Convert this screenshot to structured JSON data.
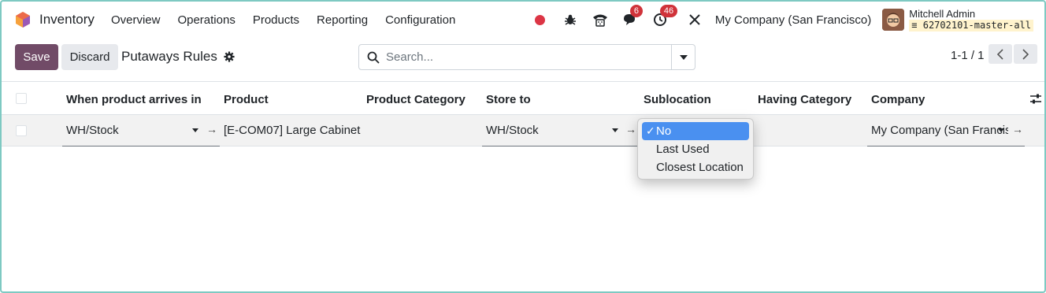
{
  "app": {
    "name": "Inventory",
    "menu": [
      "Overview",
      "Operations",
      "Products",
      "Reporting",
      "Configuration"
    ]
  },
  "systray": {
    "messages_count": "6",
    "activities_count": "46",
    "company": "My Company (San Francisco)",
    "user_name": "Mitchell Admin",
    "database": "62702101-master-all"
  },
  "control_panel": {
    "save_label": "Save",
    "discard_label": "Discard",
    "breadcrumb": "Putaways Rules",
    "search_placeholder": "Search...",
    "pager": "1-1 / 1"
  },
  "table": {
    "columns": [
      "When product arrives in",
      "Product",
      "Product Category",
      "Store to",
      "Sublocation",
      "Having Category",
      "Company"
    ],
    "rows": [
      {
        "location_in": "WH/Stock",
        "product": "[E-COM07] Large Cabinet",
        "product_category": "",
        "store_to": "WH/Stock",
        "sublocation": "No",
        "having_category": "",
        "company": "My Company (San Francisco)"
      }
    ]
  },
  "sublocation_dropdown": {
    "options": [
      "No",
      "Last Used",
      "Closest Location"
    ],
    "selected": "No",
    "check_glyph": "✓"
  },
  "colors": {
    "brand": "#714b67",
    "selected_option": "#4a90f0",
    "badge": "#d0333a"
  }
}
